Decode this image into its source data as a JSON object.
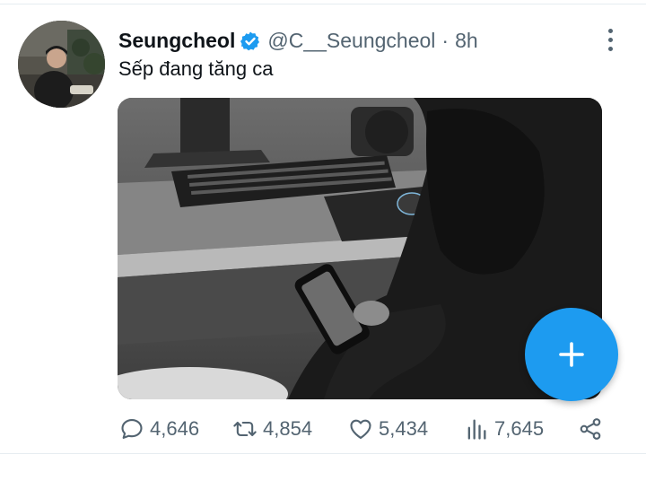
{
  "tweet": {
    "display_name": "Seungcheol",
    "handle": "@C__Seungcheol",
    "separator": "·",
    "time": "8h",
    "text": "Sếp đang tăng ca",
    "verified": true
  },
  "actions": {
    "replies": "4,646",
    "retweets": "4,854",
    "likes": "5,434",
    "views": "7,645"
  },
  "icons": {
    "verified": "verified-badge-icon",
    "more": "more-vertical-icon",
    "reply": "reply-icon",
    "retweet": "retweet-icon",
    "like": "heart-icon",
    "views": "views-bar-chart-icon",
    "share": "share-icon",
    "compose": "plus-icon"
  },
  "colors": {
    "accent": "#1d9bf0",
    "text_primary": "#0f1419",
    "text_secondary": "#536471",
    "divider": "#e6ecf0"
  }
}
